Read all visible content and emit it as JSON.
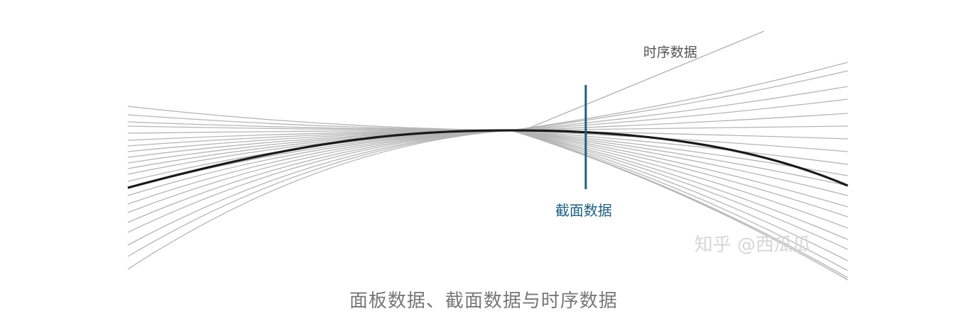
{
  "figure": {
    "timeseries_label": "时序数据",
    "cross_section_label": "截面数据",
    "watermark": "知乎 @西瓜瓜",
    "caption": "面板数据、截面数据与时序数据",
    "colors": {
      "curves": "#b5b5b5",
      "mean_curve": "#1a1a1a",
      "cross_section_line": "#1e5f80",
      "caption": "#777777"
    }
  }
}
